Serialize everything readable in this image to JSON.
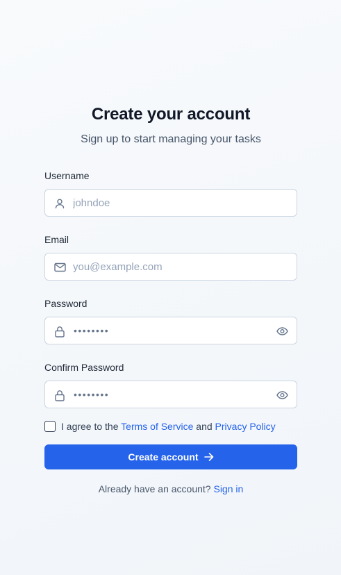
{
  "header": {
    "title": "Create your account",
    "subtitle": "Sign up to start managing your tasks"
  },
  "form": {
    "username": {
      "label": "Username",
      "placeholder": "johndoe",
      "icon": "user-icon"
    },
    "email": {
      "label": "Email",
      "placeholder": "you@example.com",
      "icon": "mail-icon"
    },
    "password": {
      "label": "Password",
      "masked_value": "••••••••",
      "icon": "lock-icon",
      "toggle_icon": "eye-icon"
    },
    "confirm_password": {
      "label": "Confirm Password",
      "masked_value": "••••••••",
      "icon": "lock-icon",
      "toggle_icon": "eye-icon"
    },
    "agree": {
      "prefix": "I agree to the",
      "terms_link": "Terms of Service",
      "conjunction": "and",
      "privacy_link": "Privacy Policy",
      "checked": false
    },
    "submit_label": "Create account"
  },
  "footer": {
    "prompt": "Already have an account?",
    "signin_link": "Sign in"
  },
  "colors": {
    "accent": "#2563eb",
    "border": "#cbd5e1",
    "icon": "#64748b",
    "placeholder": "#94a3b8"
  }
}
